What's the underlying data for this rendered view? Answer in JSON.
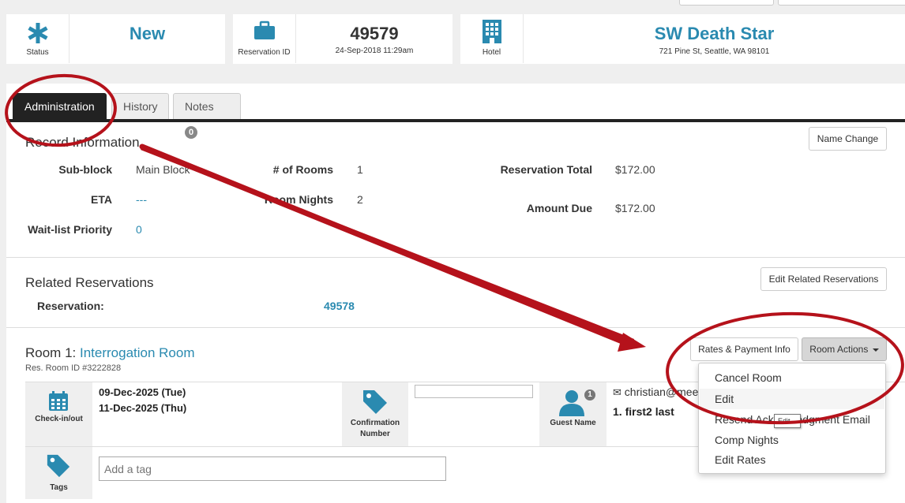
{
  "header": {
    "status_caption": "Status",
    "status_value": "New",
    "reservation_caption": "Reservation ID",
    "reservation_id": "49579",
    "reservation_date": "24-Sep-2018 11:29am",
    "hotel_caption": "Hotel",
    "hotel_name": "SW Death Star",
    "hotel_address": "721 Pine St, Seattle, WA 98101"
  },
  "tabs": [
    {
      "label": "Administration",
      "active": true
    },
    {
      "label": "History"
    },
    {
      "label": "Notes",
      "badge": "0"
    }
  ],
  "record": {
    "title": "Record Information",
    "name_change_label": "Name Change",
    "sub_block_label": "Sub-block",
    "sub_block_value": "Main Block",
    "eta_label": "ETA",
    "eta_value": "---",
    "waitlist_label": "Wait-list Priority",
    "waitlist_value": "0",
    "rooms_label": "# of Rooms",
    "rooms_value": "1",
    "room_nights_label": "Room Nights",
    "room_nights_value": "2",
    "total_label": "Reservation Total",
    "total_value": "$172.00",
    "due_label": "Amount Due",
    "due_value": "$172.00"
  },
  "related": {
    "title": "Related Reservations",
    "edit_label": "Edit Related Reservations",
    "reservation_label": "Reservation:",
    "reservation_value": "49578"
  },
  "room": {
    "title_prefix": "Room 1:",
    "room_name": "Interrogation Room",
    "res_room_id": "Res. Room ID #3222828",
    "rates_btn": "Rates & Payment Info",
    "actions_btn": "Room Actions",
    "checkin_caption": "Check-in/out",
    "checkin_date": "09-Dec-2025 (Tue)",
    "checkout_date": "11-Dec-2025 (Thu)",
    "confirmation_caption_1": "Confirmation",
    "confirmation_caption_2": "Number",
    "guest_caption": "Guest Name",
    "guest_count": "1",
    "guest_email": "christian@mee",
    "guest_name": "1. first2 last",
    "tags_caption": "Tags",
    "tag_placeholder": "Add a tag"
  },
  "room_actions_menu": [
    {
      "label": "Cancel Room"
    },
    {
      "label": "Edit"
    },
    {
      "label": "Resend Acknowledgment Email"
    },
    {
      "label": "Comp Nights"
    },
    {
      "label": "Edit Rates"
    }
  ],
  "tooltip": "Edit",
  "colors": {
    "accent": "#2a8ab0",
    "annotation": "#b5121b",
    "tab_active": "#222222"
  }
}
